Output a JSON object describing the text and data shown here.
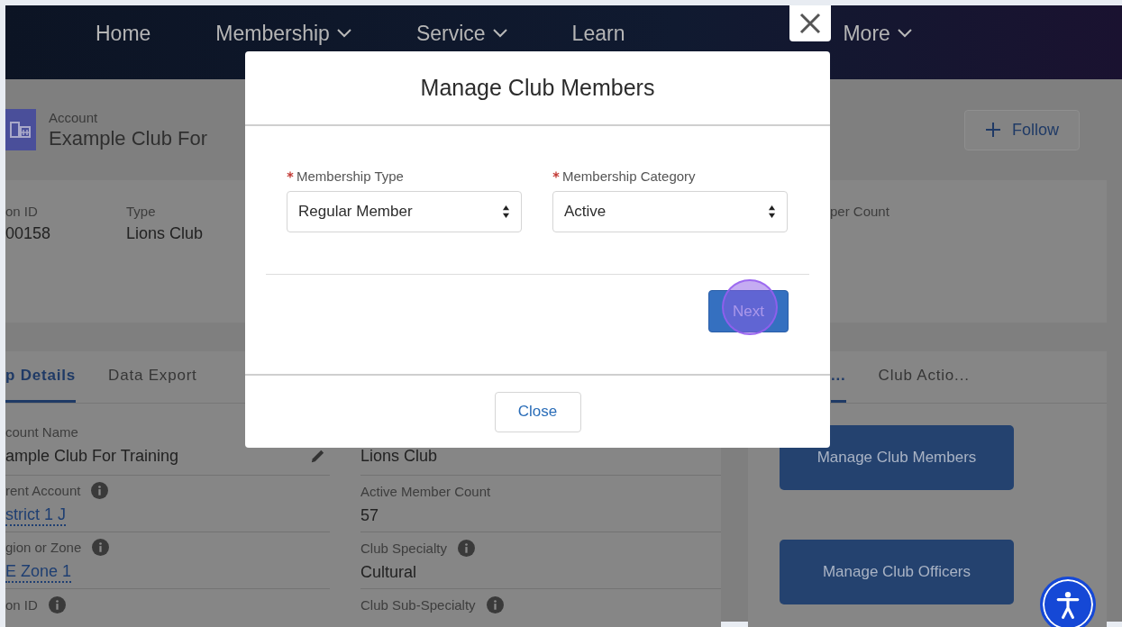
{
  "nav": {
    "items": [
      {
        "label": "Home",
        "dropdown": false
      },
      {
        "label": "Membership",
        "dropdown": true
      },
      {
        "label": "Service",
        "dropdown": true
      },
      {
        "label": "Learn",
        "dropdown": false
      },
      {
        "label": "More",
        "dropdown": true
      }
    ]
  },
  "record_header": {
    "object_type": "Account",
    "name": "Example Club For",
    "follow_button": "Follow"
  },
  "highlights": [
    {
      "label": "on ID",
      "value": "00158"
    },
    {
      "label": "Type",
      "value": "Lions Club"
    },
    {
      "label": "per Count"
    }
  ],
  "tabs": [
    {
      "label": "p Details",
      "selected": true
    },
    {
      "label": "Data Export",
      "selected": false
    }
  ],
  "details": {
    "left": [
      {
        "label": "count Name",
        "info": false,
        "value": "ample Club For Training",
        "link": false,
        "editable": true
      },
      {
        "label": "rent Account",
        "info": true,
        "value": "strict 1 J",
        "link": true,
        "editable": false
      },
      {
        "label": "gion or Zone",
        "info": true,
        "value": "E Zone 1",
        "link": true,
        "editable": false
      },
      {
        "label": "on ID",
        "info": true,
        "link": false,
        "editable": false
      }
    ],
    "right": [
      {
        "info": false,
        "value": "Lions Club",
        "link": false,
        "editable": false
      },
      {
        "label": "Active Member Count",
        "info": false,
        "value": "57",
        "link": false,
        "editable": false
      },
      {
        "label": "Club Specialty",
        "info": true,
        "value": "Cultural",
        "link": false,
        "editable": false
      },
      {
        "label": "Club Sub-Specialty",
        "info": true,
        "link": false,
        "editable": false
      }
    ]
  },
  "side_tabs": [
    {
      "label": "...",
      "selected": true
    },
    {
      "label": "Club Actio...",
      "selected": false
    }
  ],
  "actions": [
    {
      "label": "Manage Club Members"
    },
    {
      "label": "Manage Club Officers"
    }
  ],
  "modal": {
    "title": "Manage Club Members",
    "fields": [
      {
        "label": "Membership Type",
        "required": true,
        "value": "Regular Member"
      },
      {
        "label": "Membership Category",
        "required": true,
        "value": "Active"
      }
    ],
    "next_button": "Next",
    "close_button": "Close"
  }
}
